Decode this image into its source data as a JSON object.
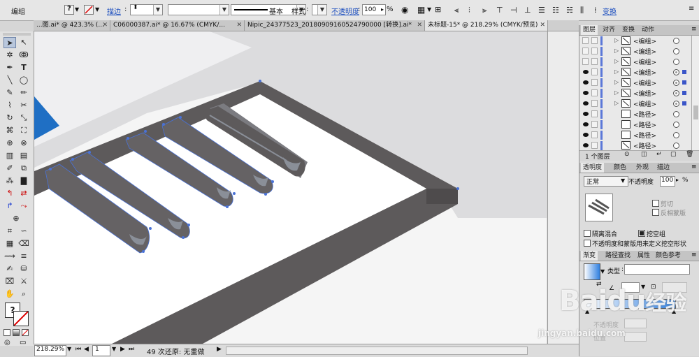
{
  "control_bar": {
    "selection_label": "编组",
    "stroke_label": "描边",
    "stroke_value": "",
    "brush_value": "",
    "stroke_profile_label": "基本",
    "style_label": "样式",
    "opacity_label": "不透明度",
    "opacity_value": "100",
    "opacity_unit": "%",
    "transform_label": "变换"
  },
  "tabs": [
    {
      "label": "...图.ai* @ 423.3% (...",
      "active": false
    },
    {
      "label": "C06000387.ai* @ 16.67% (CMYK/...",
      "active": false
    },
    {
      "label": "Nipic_24377523_20180909160524790000 [转换].ai*",
      "active": false
    },
    {
      "label": "未标题-15* @ 218.29% (CMYK/预览)",
      "active": true
    }
  ],
  "status": {
    "zoom": "218.29%",
    "page": "1",
    "undo_text": "49 次还原: 无重做"
  },
  "layers_panel": {
    "tabs": [
      "图层",
      "对齐",
      "变换",
      "动作"
    ],
    "rows": [
      {
        "name": "<编组>",
        "eye": false,
        "expand": true,
        "thumb": "group",
        "selected": false
      },
      {
        "name": "<编组>",
        "eye": false,
        "expand": true,
        "thumb": "group",
        "selected": false
      },
      {
        "name": "<编组>",
        "eye": false,
        "expand": true,
        "thumb": "group",
        "selected": false
      },
      {
        "name": "<编组>",
        "eye": true,
        "expand": true,
        "thumb": "group",
        "selected": true
      },
      {
        "name": "<编组>",
        "eye": true,
        "expand": true,
        "thumb": "group",
        "selected": true
      },
      {
        "name": "<编组>",
        "eye": true,
        "expand": true,
        "thumb": "group",
        "selected": true
      },
      {
        "name": "<编组>",
        "eye": true,
        "expand": true,
        "thumb": "group",
        "selected": true
      },
      {
        "name": "<路径>",
        "eye": true,
        "expand": false,
        "thumb": "blank",
        "selected": false
      },
      {
        "name": "<路径>",
        "eye": true,
        "expand": false,
        "thumb": "blank",
        "selected": false
      },
      {
        "name": "<路径>",
        "eye": true,
        "expand": false,
        "thumb": "blank",
        "selected": false
      },
      {
        "name": "<路径>",
        "eye": true,
        "expand": false,
        "thumb": "group",
        "selected": false
      }
    ],
    "footer_count": "1 个图层"
  },
  "transparency_panel": {
    "tabs": [
      "透明度",
      "颜色",
      "外观",
      "描边"
    ],
    "blend_mode": "正常",
    "opacity_label": "不透明度",
    "opacity_value": "100",
    "opacity_unit": "%",
    "clip_label": "剪切",
    "invert_mask_label": "反相蒙版",
    "isolate_blend_label": "隔离混合",
    "knockout_group_label": "挖空组",
    "opacity_mask_label": "不透明度和蒙版用来定义挖空形状"
  },
  "gradient_panel": {
    "tabs": [
      "渐变",
      "路径查找",
      "属性",
      "颜色参考"
    ],
    "type_label": "类型",
    "type_value": "",
    "opacity_label": "不透明度",
    "position_label": "位置",
    "gradient_colors": [
      "#ffffff",
      "#2f7fe0"
    ]
  },
  "watermark": {
    "brand": "Baidu",
    "brand_cn": "经验",
    "url": "jingyan.baidu.com"
  },
  "colors": {
    "artboard_bg": "#f5f5f5",
    "shadow_grey": "#dcdcde",
    "keyboard_dark": "#5d5a5b",
    "key_highlight": "#8a8f98",
    "selection_blue": "#4a72d6",
    "accent_triangle": "#1f6fc4"
  }
}
